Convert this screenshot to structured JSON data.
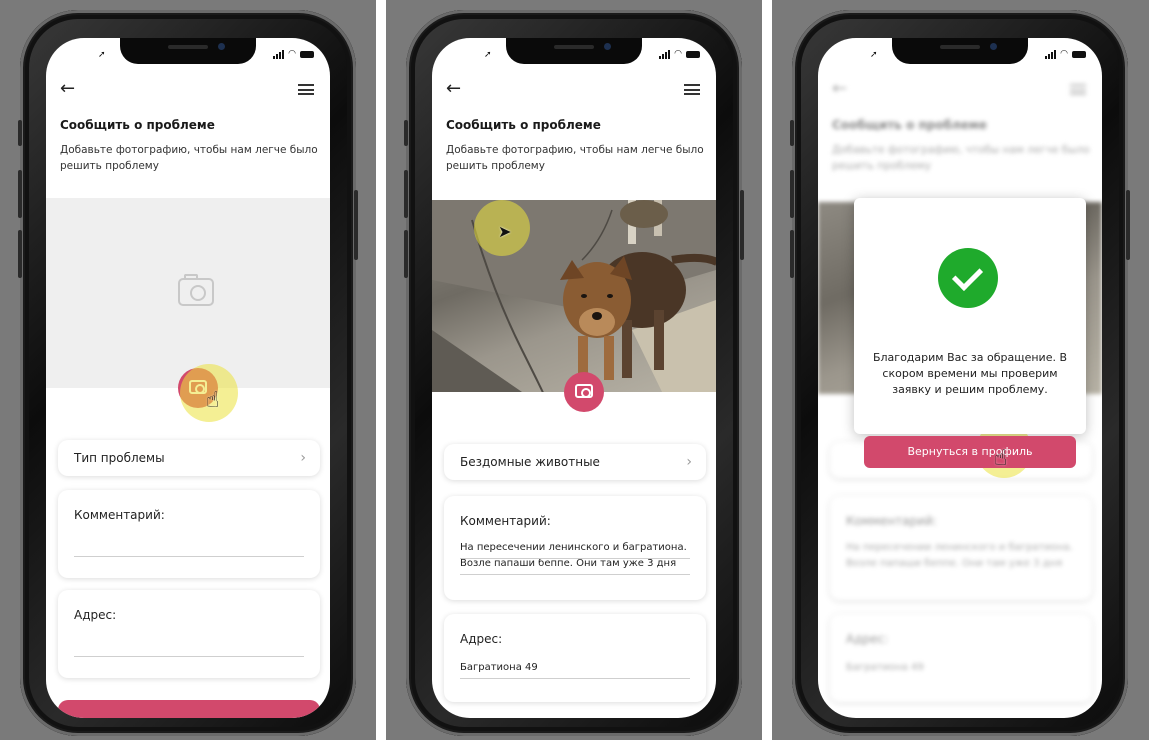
{
  "colors": {
    "accent": "#d2496c",
    "success": "#1faa2c",
    "highlight": "#ebe13c"
  },
  "screens": [
    {
      "title": "Сообщить о проблеме",
      "subtitle": "Добавьте фотографию, чтобы нам легче было решить проблему",
      "problem_type": "Тип проблемы",
      "comment_label": "Комментарий:",
      "comment_value": "",
      "address_label": "Адрес:",
      "address_value": ""
    },
    {
      "title": "Сообщить о проблеме",
      "subtitle": "Добавьте фотографию, чтобы нам легче было решить проблему",
      "problem_type": "Бездомные животные",
      "comment_label": "Комментарий:",
      "comment_value": "На пересечении ленинского и багратиона. Возле папаши беппе. Они там уже 3 дня",
      "address_label": "Адрес:",
      "address_value": "Багратиона 49"
    },
    {
      "title": "Сообщить о проблеме",
      "subtitle": "Добавьте фотографию, чтобы нам легче было решить проблему",
      "comment_label": "Комментарий:",
      "comment_value": "На пересечении ленинского и багратиона. Возле папаши беппе. Они там уже 3 дня",
      "address_label": "Адрес:",
      "address_value": "Багратиона 49",
      "modal": {
        "message": "Благодарим Вас за обращение. В скором времени мы проверим заявку и решим проблему.",
        "button": "Вернуться в профиль"
      }
    }
  ],
  "icons": [
    "back-arrow-icon",
    "menu-icon",
    "camera-icon",
    "chevron-right-icon",
    "hand-cursor-icon",
    "arrow-cursor-icon",
    "check-icon"
  ]
}
